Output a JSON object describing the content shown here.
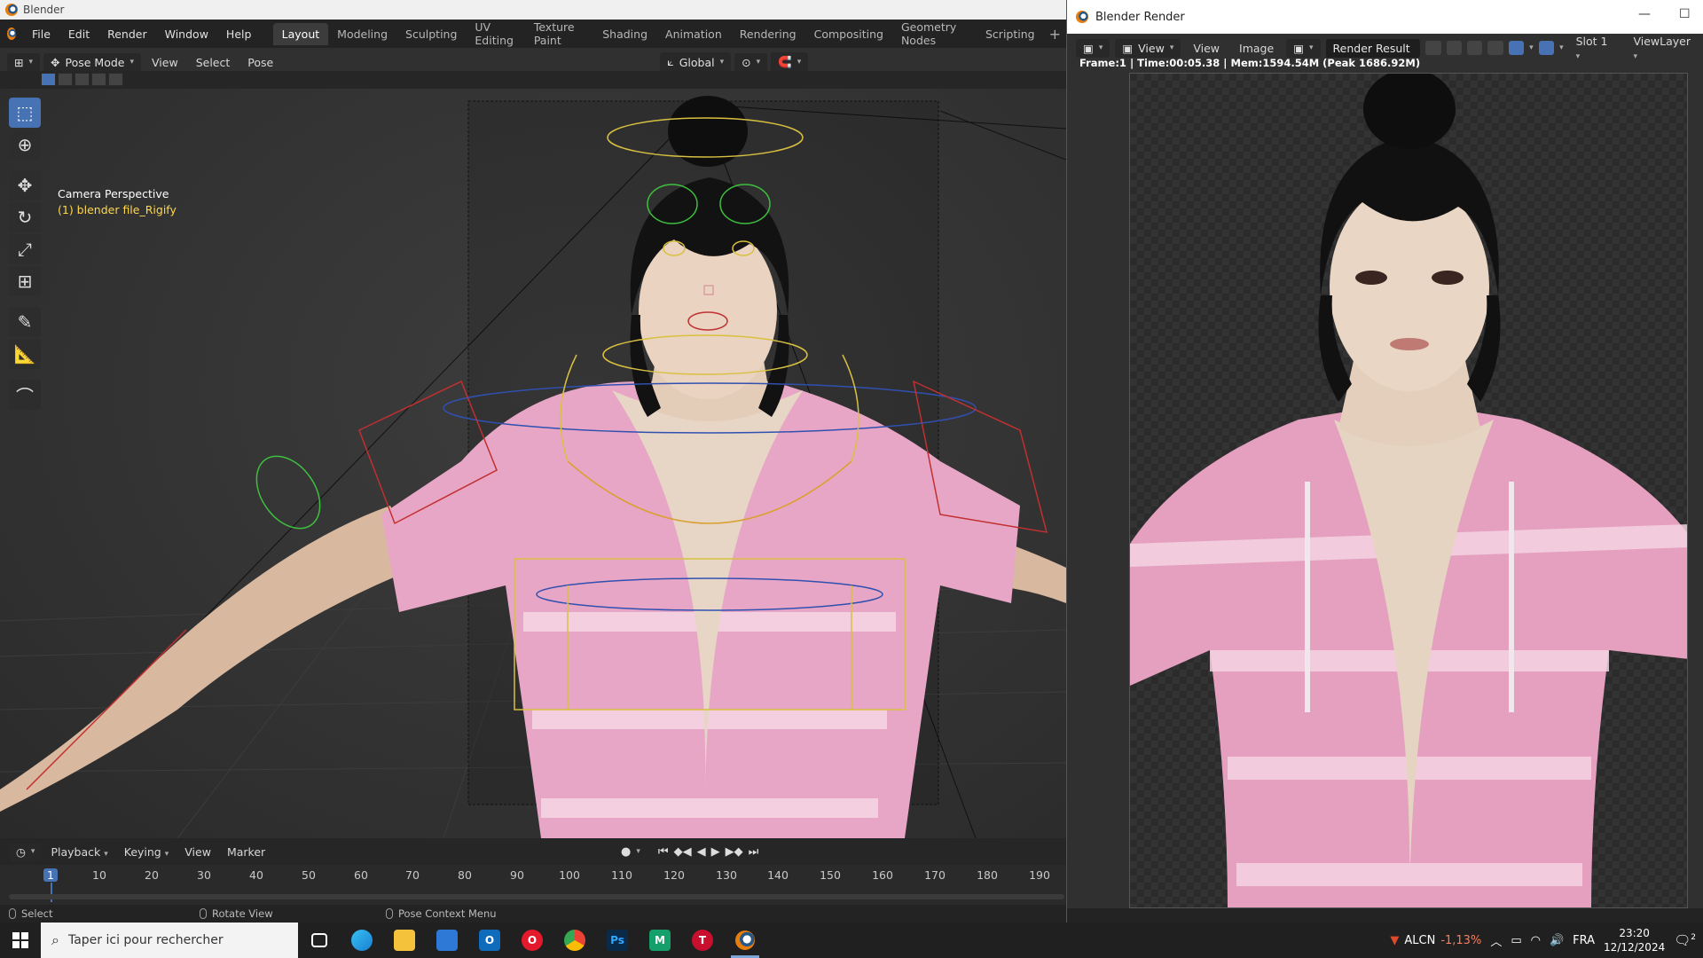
{
  "os_title": "Blender",
  "menu": [
    "File",
    "Edit",
    "Render",
    "Window",
    "Help"
  ],
  "workspaces": [
    "Layout",
    "Modeling",
    "Sculpting",
    "UV Editing",
    "Texture Paint",
    "Shading",
    "Animation",
    "Rendering",
    "Compositing",
    "Geometry Nodes",
    "Scripting"
  ],
  "active_workspace": "Layout",
  "header": {
    "mode": "Pose Mode",
    "view": "View",
    "select": "Select",
    "pose": "Pose",
    "orientation": "Global"
  },
  "viewport": {
    "camera_label": "Camera Perspective",
    "object_label": "(1) blender file_Rigify"
  },
  "timeline": {
    "playback": "Playback",
    "keying": "Keying",
    "view": "View",
    "marker": "Marker",
    "current_frame": "1",
    "ticks": [
      "10",
      "20",
      "30",
      "40",
      "50",
      "60",
      "70",
      "80",
      "90",
      "100",
      "110",
      "120",
      "130",
      "140",
      "150",
      "160",
      "170",
      "180",
      "190"
    ]
  },
  "status": {
    "select": "Select",
    "rotate": "Rotate View",
    "context": "Pose Context Menu"
  },
  "render_window": {
    "title": "Blender Render",
    "view_menu": "View",
    "view2": "View",
    "image": "Image",
    "image_name": "Render Result",
    "slot": "Slot 1",
    "view_layer": "ViewLayer",
    "stats": "Frame:1 | Time:00:05.38 | Mem:1594.54M (Peak 1686.92M)"
  },
  "taskbar": {
    "search_placeholder": "Taper ici pour rechercher",
    "stock_label": "ALCN",
    "stock_change": "-1,13%",
    "language": "FRA",
    "time": "23:20",
    "date": "12/12/2024",
    "notif_count": "2"
  },
  "colors": {
    "accent": "#4772b3",
    "viewport_text_yellow": "#ffd84a",
    "suit_pink": "#e9a3c4",
    "skin": "#e9d8c6",
    "hair": "#111111"
  }
}
